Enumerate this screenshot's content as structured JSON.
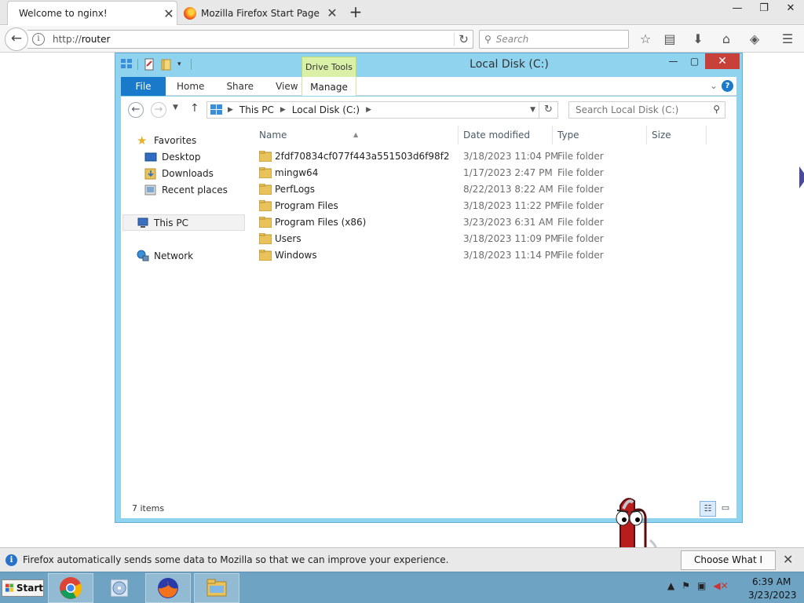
{
  "firefox": {
    "tabs": [
      {
        "title": "Welcome to nginx!"
      },
      {
        "title": "Mozilla Firefox Start Page"
      }
    ],
    "new_tab": "+",
    "url_prefix": "http://",
    "url_host": "router",
    "search_placeholder": "Search"
  },
  "explorer": {
    "title": "Local Disk (C:)",
    "context_tab": "Drive Tools",
    "ribbon_tabs": {
      "file": "File",
      "home": "Home",
      "share": "Share",
      "view": "View",
      "manage": "Manage"
    },
    "breadcrumb": [
      "This PC",
      "Local Disk (C:)"
    ],
    "search_placeholder": "Search Local Disk (C:)",
    "nav": {
      "favorites": "Favorites",
      "desktop": "Desktop",
      "downloads": "Downloads",
      "recent": "Recent places",
      "thispc": "This PC",
      "network": "Network"
    },
    "columns": {
      "name": "Name",
      "date": "Date modified",
      "type": "Type",
      "size": "Size"
    },
    "files": [
      {
        "name": "2fdf70834cf077f443a551503d6f98f2",
        "date": "3/18/2023 11:04 PM",
        "type": "File folder"
      },
      {
        "name": "mingw64",
        "date": "1/17/2023 2:47 PM",
        "type": "File folder"
      },
      {
        "name": "PerfLogs",
        "date": "8/22/2013 8:22 AM",
        "type": "File folder"
      },
      {
        "name": "Program Files",
        "date": "3/18/2023 11:22 PM",
        "type": "File folder"
      },
      {
        "name": "Program Files (x86)",
        "date": "3/23/2023 6:31 AM",
        "type": "File folder"
      },
      {
        "name": "Users",
        "date": "3/18/2023 11:09 PM",
        "type": "File folder"
      },
      {
        "name": "Windows",
        "date": "3/18/2023 11:14 PM",
        "type": "File folder"
      }
    ],
    "status": "7 items"
  },
  "notification": {
    "text": "Firefox automatically sends some data to Mozilla so that we can improve your experience.",
    "button": "Choose What I Share"
  },
  "taskbar": {
    "start": "Start",
    "time": "6:39 AM",
    "date": "3/23/2023"
  },
  "colors": {
    "explorer_frame": "#8fd3ee",
    "ribbon_file": "#1979ca",
    "drive_tools": "#d9f0a6",
    "close_button": "#c7403a",
    "taskbar": "#6ea3c4",
    "folder": "#e8c25a"
  }
}
